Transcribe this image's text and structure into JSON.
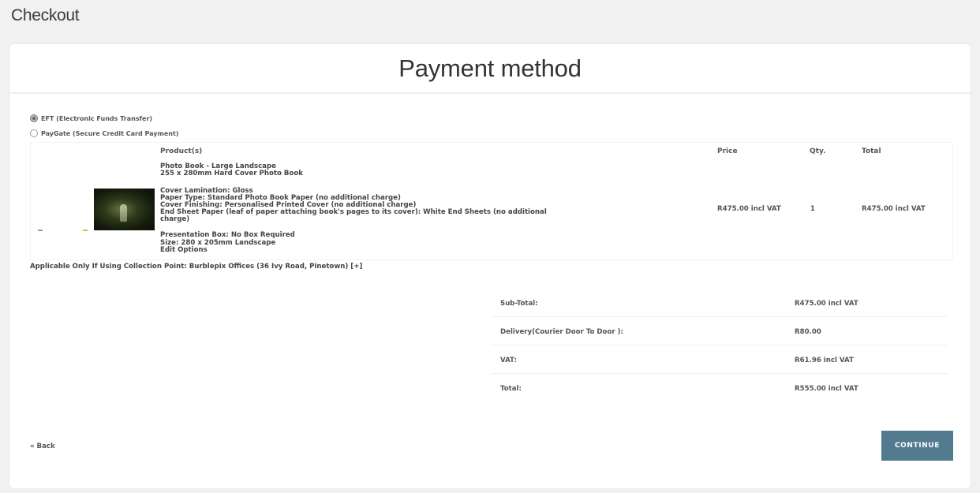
{
  "page": {
    "header": "Checkout"
  },
  "card": {
    "title": "Payment method"
  },
  "payment_options": [
    {
      "label": "EFT (Electronic Funds Transfer)",
      "selected": true
    },
    {
      "label": "PayGate (Secure Credit Card Payment)",
      "selected": false
    }
  ],
  "products_table": {
    "headers": {
      "product": "Product(s)",
      "price": "Price",
      "qty": "Qty.",
      "total": "Total"
    },
    "item": {
      "name": "Photo Book - Large Landscape",
      "spec": "255 x 280mm Hard Cover Photo Book",
      "options": [
        "Cover Lamination: Gloss",
        "Paper Type: Standard Photo Book Paper (no additional charge)",
        "Cover Finishing: Personalised Printed Cover (no additional charge)",
        "End Sheet Paper (leaf of paper attaching book's pages to its cover): White End Sheets (no additional",
        "charge)",
        "Presentation Box: No Box Required",
        "Size: 280 x 205mm Landscape",
        "Edit Options"
      ],
      "price": "R475.00 incl VAT",
      "qty": "1",
      "total": "R475.00 incl VAT"
    }
  },
  "collection_note": "Applicable Only If Using Collection Point: Burblepix Offices (36 Ivy Road, Pinetown) [+]",
  "totals": [
    {
      "label": "Sub-Total:",
      "value": "R475.00 incl VAT"
    },
    {
      "label": "Delivery(Courier Door To Door ):",
      "value": "R80.00"
    },
    {
      "label": "VAT:",
      "value": "R61.96 incl VAT"
    },
    {
      "label": "Total:",
      "value": "R555.00 incl VAT"
    }
  ],
  "nav": {
    "back_label": "« Back",
    "continue_label": "CONTINUE"
  },
  "colors": {
    "continue_button": "#537b90",
    "page_background": "#f1f1f1"
  }
}
